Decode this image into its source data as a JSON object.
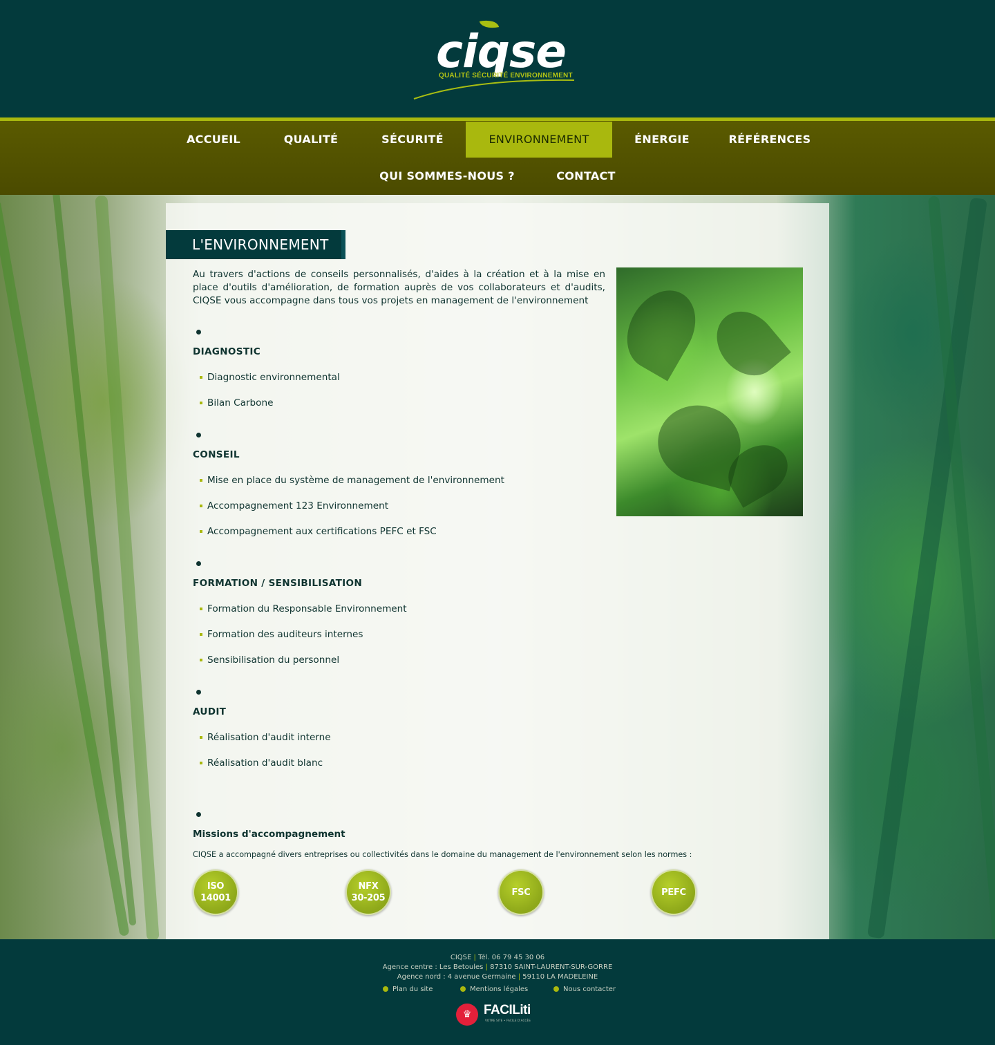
{
  "header": {
    "logo_word": "ciqse",
    "logo_tagline": "QUALITÉ SÉCURITÉ ENVIRONNEMENT"
  },
  "nav": {
    "items": [
      {
        "label": "ACCUEIL"
      },
      {
        "label": "QUALITÉ"
      },
      {
        "label": "SÉCURITÉ"
      },
      {
        "label": "ENVIRONNEMENT",
        "active": true
      },
      {
        "label": "ÉNERGIE"
      },
      {
        "label": "RÉFÉRENCES"
      },
      {
        "label": "QUI SOMMES-NOUS ?"
      },
      {
        "label": "CONTACT"
      }
    ]
  },
  "main": {
    "title": "L'ENVIRONNEMENT",
    "intro": "Au travers d'actions de conseils personnalisés, d'aides à la création et à la mise en place d'outils d'amélioration, de formation auprès de vos collaborateurs et d'audits, CIQSE vous accompagne dans tous vos projets en management de l'environnement",
    "sections": [
      {
        "title": "DIAGNOSTIC",
        "items": [
          "Diagnostic environnemental",
          "Bilan Carbone"
        ]
      },
      {
        "title": "CONSEIL",
        "items": [
          "Mise en place du système de management de l'environnement",
          "Accompagnement 123 Environnement",
          "Accompagnement aux certifications PEFC et FSC"
        ]
      },
      {
        "title": "FORMATION / SENSIBILISATION",
        "items": [
          "Formation du Responsable Environnement",
          "Formation des auditeurs internes",
          "Sensibilisation du personnel"
        ]
      },
      {
        "title": "AUDIT",
        "items": [
          "Réalisation d'audit interne",
          "Réalisation d'audit blanc"
        ]
      }
    ],
    "missions": {
      "title": "Missions d'accompagnement",
      "text": "CIQSE a accompagné divers entreprises ou collectivités dans le domaine du management de l'environnement selon les normes :",
      "badges": [
        {
          "line1": "ISO",
          "line2": "14001"
        },
        {
          "line1": "NFX",
          "line2": "30-205"
        },
        {
          "line1": "FSC",
          "line2": ""
        },
        {
          "line1": "PEFC",
          "line2": ""
        }
      ]
    }
  },
  "footer": {
    "company": "CIQSE",
    "phone": "Tél. 06 79 45 30 06",
    "agence_centre": "Agence centre : Les Betoules",
    "agence_centre_city": "87310 SAINT-LAURENT-SUR-GORRE",
    "agence_nord": "Agence nord : 4 avenue Germaine",
    "agence_nord_city": "59110 LA MADELEINE",
    "links": [
      "Plan du site",
      "Mentions légales",
      "Nous contacter"
    ],
    "faciliti_word": "FACILiti",
    "faciliti_sub": "VOTRE SITE • FACILE D'ACCÈS"
  },
  "colors": {
    "dark_teal": "#033a3c",
    "olive_nav": "#555500",
    "accent_green": "#a9b80e"
  }
}
